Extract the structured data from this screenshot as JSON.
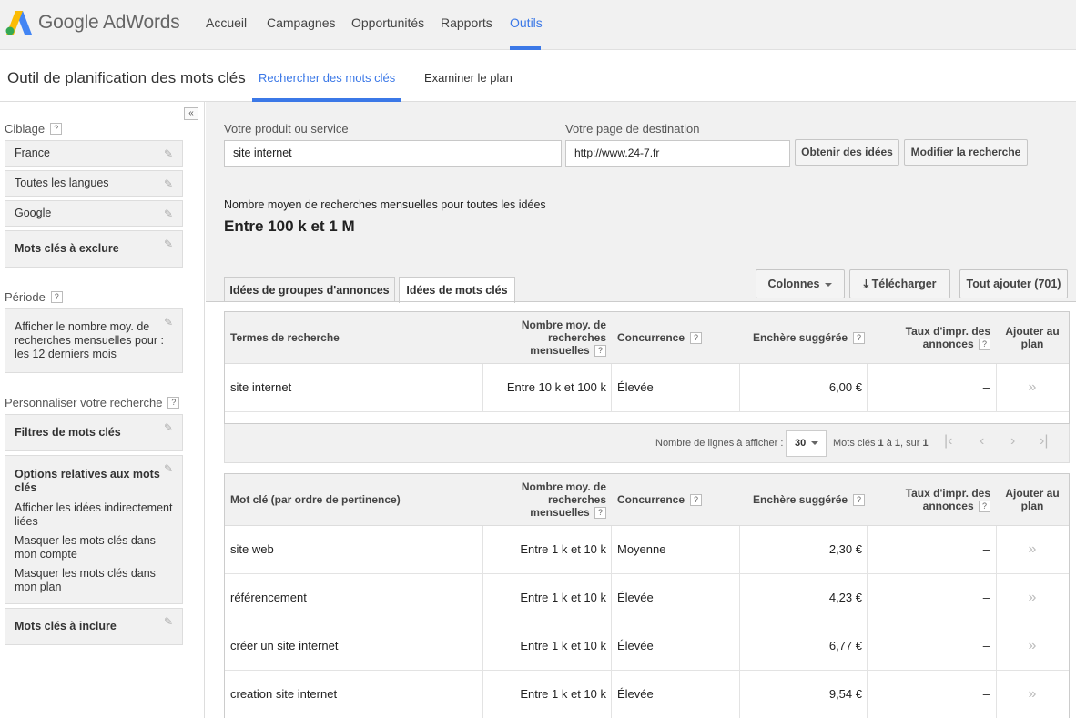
{
  "app": {
    "brand": "Google AdWords",
    "accent_color": "#3b78e7"
  },
  "nav": [
    {
      "label": "Accueil"
    },
    {
      "label": "Campagnes"
    },
    {
      "label": "Opportunités"
    },
    {
      "label": "Rapports"
    },
    {
      "label": "Outils",
      "active": true
    }
  ],
  "subheader": {
    "title": "Outil de planification des mots clés",
    "tabs": [
      {
        "label": "Rechercher des mots clés",
        "active": true
      },
      {
        "label": "Examiner le plan"
      }
    ]
  },
  "sidebar": {
    "collapse_icon": "«",
    "targeting_label": "Ciblage",
    "targeting": [
      {
        "label": "France"
      },
      {
        "label": "Toutes les langues"
      },
      {
        "label": "Google"
      },
      {
        "label": "Mots clés à exclure"
      }
    ],
    "period_label": "Période",
    "period_text": "Afficher le nombre moy. de recherches mensuelles pour : les 12 derniers mois",
    "customize_label": "Personnaliser votre recherche",
    "keyword_filters": "Filtres de mots clés",
    "options_title": "Options relatives aux mots clés",
    "options": [
      "Afficher les idées indirectement liées",
      "Masquer les mots clés dans mon compte",
      "Masquer les mots clés dans mon plan"
    ],
    "include_keywords": "Mots clés à inclure",
    "help_glyph": "?"
  },
  "search": {
    "product_label": "Votre produit ou service",
    "product_value": "site internet",
    "landing_label": "Votre page de destination",
    "landing_value": "http://www.24-7.fr",
    "get_ideas": "Obtenir des idées",
    "modify_search": "Modifier la recherche"
  },
  "summary": {
    "label": "Nombre moyen de recherches mensuelles pour toutes les idées",
    "value": "Entre 100 k et 1 M"
  },
  "tabs": {
    "ad_groups": "Idées de groupes d'annonces",
    "keywords": "Idées de mots clés",
    "columns": "Colonnes",
    "download": "Télécharger",
    "add_all": "Tout ajouter (701)"
  },
  "headers": {
    "search_terms": "Termes de recherche",
    "keyword": "Mot clé (par ordre de pertinence)",
    "avg_searches_1": "Nombre moy. de",
    "avg_searches_2": "recherches",
    "avg_searches_3": "mensuelles",
    "competition": "Concurrence",
    "suggested_bid": "Enchère suggérée",
    "impr_share_1": "Taux d'impr. des",
    "impr_share_2": "annonces",
    "add_plan_1": "Ajouter au",
    "add_plan_2": "plan"
  },
  "search_terms_rows": [
    {
      "term": "site internet",
      "searches": "Entre 10 k et 100 k",
      "competition": "Élevée",
      "bid": "6,00 €",
      "share": "–",
      "add": "»"
    }
  ],
  "pager": {
    "rows_label": "Nombre de lignes à afficher :",
    "rows_value": "30",
    "range_prefix": "Mots clés",
    "range_from": "1",
    "range_mid": "à",
    "range_to": "1",
    "range_sep": ", sur",
    "range_total": "1",
    "first": "|‹",
    "prev": "‹",
    "next": "›",
    "last": "›|"
  },
  "keyword_rows": [
    {
      "term": "site web",
      "searches": "Entre 1 k et 10 k",
      "competition": "Moyenne",
      "bid": "2,30 €",
      "share": "–",
      "add": "»"
    },
    {
      "term": "référencement",
      "searches": "Entre 1 k et 10 k",
      "competition": "Élevée",
      "bid": "4,23 €",
      "share": "–",
      "add": "»"
    },
    {
      "term": "créer un site internet",
      "searches": "Entre 1 k et 10 k",
      "competition": "Élevée",
      "bid": "6,77 €",
      "share": "–",
      "add": "»"
    },
    {
      "term": "creation site internet",
      "searches": "Entre 1 k et 10 k",
      "competition": "Élevée",
      "bid": "9,54 €",
      "share": "–",
      "add": "»"
    }
  ]
}
